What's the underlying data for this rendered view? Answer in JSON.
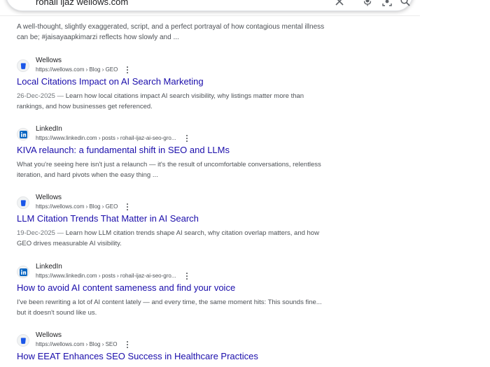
{
  "search": {
    "query": "rohail ijaz wellows.com",
    "clear_icon": "close-icon",
    "mic_icon": "mic-icon",
    "lens_icon": "lens-icon",
    "search_icon": "search-icon"
  },
  "top_snippet": "A well-thought, slightly exaggerated, script, and a perfect portrayal of how contagious mental illness can be; #jaisayaapkimarzi reflects how slowly and ...",
  "results": [
    {
      "site": "Wellows",
      "url": "https://wellows.com › Blog › GEO",
      "title": "Local Citations Impact on AI Search Marketing",
      "date": "26-Dec-2025 —",
      "snippet": "Learn how local citations impact AI search visibility, why listings matter more than rankings, and how businesses get referenced.",
      "favicon": "wellows-icon"
    },
    {
      "site": "LinkedIn",
      "url": "https://www.linkedin.com › posts › rohail-ijaz-ai-seo-gro...",
      "title": "KIVA relaunch: a fundamental shift in SEO and LLMs",
      "date": "",
      "snippet": "What you're seeing here isn't just a relaunch — it's the result of uncomfortable conversations, relentless iteration, and hard pivots when the easy thing ...",
      "favicon": "linkedin-icon"
    },
    {
      "site": "Wellows",
      "url": "https://wellows.com › Blog › GEO",
      "title": "LLM Citation Trends That Matter in AI Search",
      "date": "19-Dec-2025 —",
      "snippet": "Learn how LLM citation trends shape AI search, why citation overlap matters, and how GEO drives measurable AI visibility.",
      "favicon": "wellows-icon"
    },
    {
      "site": "LinkedIn",
      "url": "https://www.linkedin.com › posts › rohail-ijaz-ai-seo-gro...",
      "title": "How to avoid AI content sameness and find your voice",
      "date": "",
      "snippet": "I've been rewriting a lot of AI content lately — and every time, the same moment hits: This sounds fine... but it doesn't sound like us.",
      "favicon": "linkedin-icon"
    },
    {
      "site": "Wellows",
      "url": "https://wellows.com › Blog › SEO",
      "title": "How EEAT Enhances SEO Success in Healthcare Practices",
      "date": "",
      "snippet": "",
      "favicon": "wellows-icon"
    }
  ],
  "colors": {
    "link": "#1a0dab",
    "wellows_brand": "#1a56e8",
    "linkedin_brand": "#0a66c2"
  }
}
